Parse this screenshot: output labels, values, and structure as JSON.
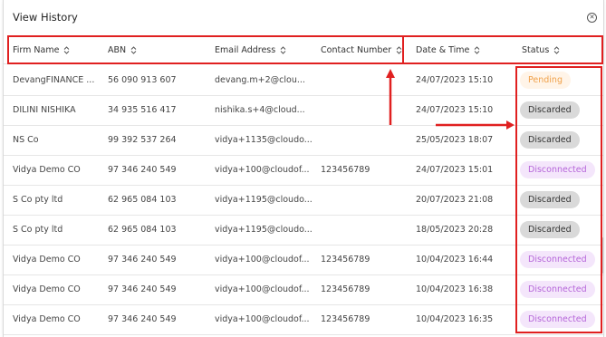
{
  "modal": {
    "title": "View History",
    "close_icon": "close-circle-icon"
  },
  "table": {
    "columns": [
      "Firm Name",
      "ABN",
      "Email Address",
      "Contact Number",
      "Date & Time",
      "Status"
    ],
    "rows": [
      {
        "firm": "DevangFINANCE ...",
        "abn": "56 090 913 607",
        "email": "devang.m+2@clou...",
        "contact": "",
        "datetime": "24/07/2023 15:10",
        "status": "Pending",
        "status_type": "pending"
      },
      {
        "firm": "DILINI NISHIKA",
        "abn": "34 935 516 417",
        "email": "nishika.s+4@cloud...",
        "contact": "",
        "datetime": "24/07/2023 15:10",
        "status": "Discarded",
        "status_type": "discarded"
      },
      {
        "firm": "NS Co",
        "abn": "99 392 537 264",
        "email": "vidya+1135@cloudo...",
        "contact": "",
        "datetime": "25/05/2023 18:07",
        "status": "Discarded",
        "status_type": "discarded"
      },
      {
        "firm": "Vidya Demo CO",
        "abn": "97 346 240 549",
        "email": "vidya+100@cloudof...",
        "contact": "123456789",
        "datetime": "24/07/2023 15:01",
        "status": "Disconnected",
        "status_type": "disconnected"
      },
      {
        "firm": "S Co pty ltd",
        "abn": "62 965 084 103",
        "email": "vidya+1195@cloudo...",
        "contact": "",
        "datetime": "20/07/2023 21:08",
        "status": "Discarded",
        "status_type": "discarded"
      },
      {
        "firm": "S Co pty ltd",
        "abn": "62 965 084 103",
        "email": "vidya+1195@cloudo...",
        "contact": "",
        "datetime": "18/05/2023 20:28",
        "status": "Discarded",
        "status_type": "discarded"
      },
      {
        "firm": "Vidya Demo CO",
        "abn": "97 346 240 549",
        "email": "vidya+100@cloudof...",
        "contact": "123456789",
        "datetime": "10/04/2023 16:44",
        "status": "Disconnected",
        "status_type": "disconnected"
      },
      {
        "firm": "Vidya Demo CO",
        "abn": "97 346 240 549",
        "email": "vidya+100@cloudof...",
        "contact": "123456789",
        "datetime": "10/04/2023 16:38",
        "status": "Disconnected",
        "status_type": "disconnected"
      },
      {
        "firm": "Vidya Demo CO",
        "abn": "97 346 240 549",
        "email": "vidya+100@cloudof...",
        "contact": "123456789",
        "datetime": "10/04/2023 16:35",
        "status": "Disconnected",
        "status_type": "disconnected"
      }
    ]
  },
  "colors": {
    "annotation": "#e02020",
    "pending_bg": "#fff4e8",
    "pending_text": "#f0a14a",
    "discarded_bg": "#d9d9d9",
    "discarded_text": "#333333",
    "disconnected_bg": "#f4e6fb",
    "disconnected_text": "#b565d9"
  }
}
